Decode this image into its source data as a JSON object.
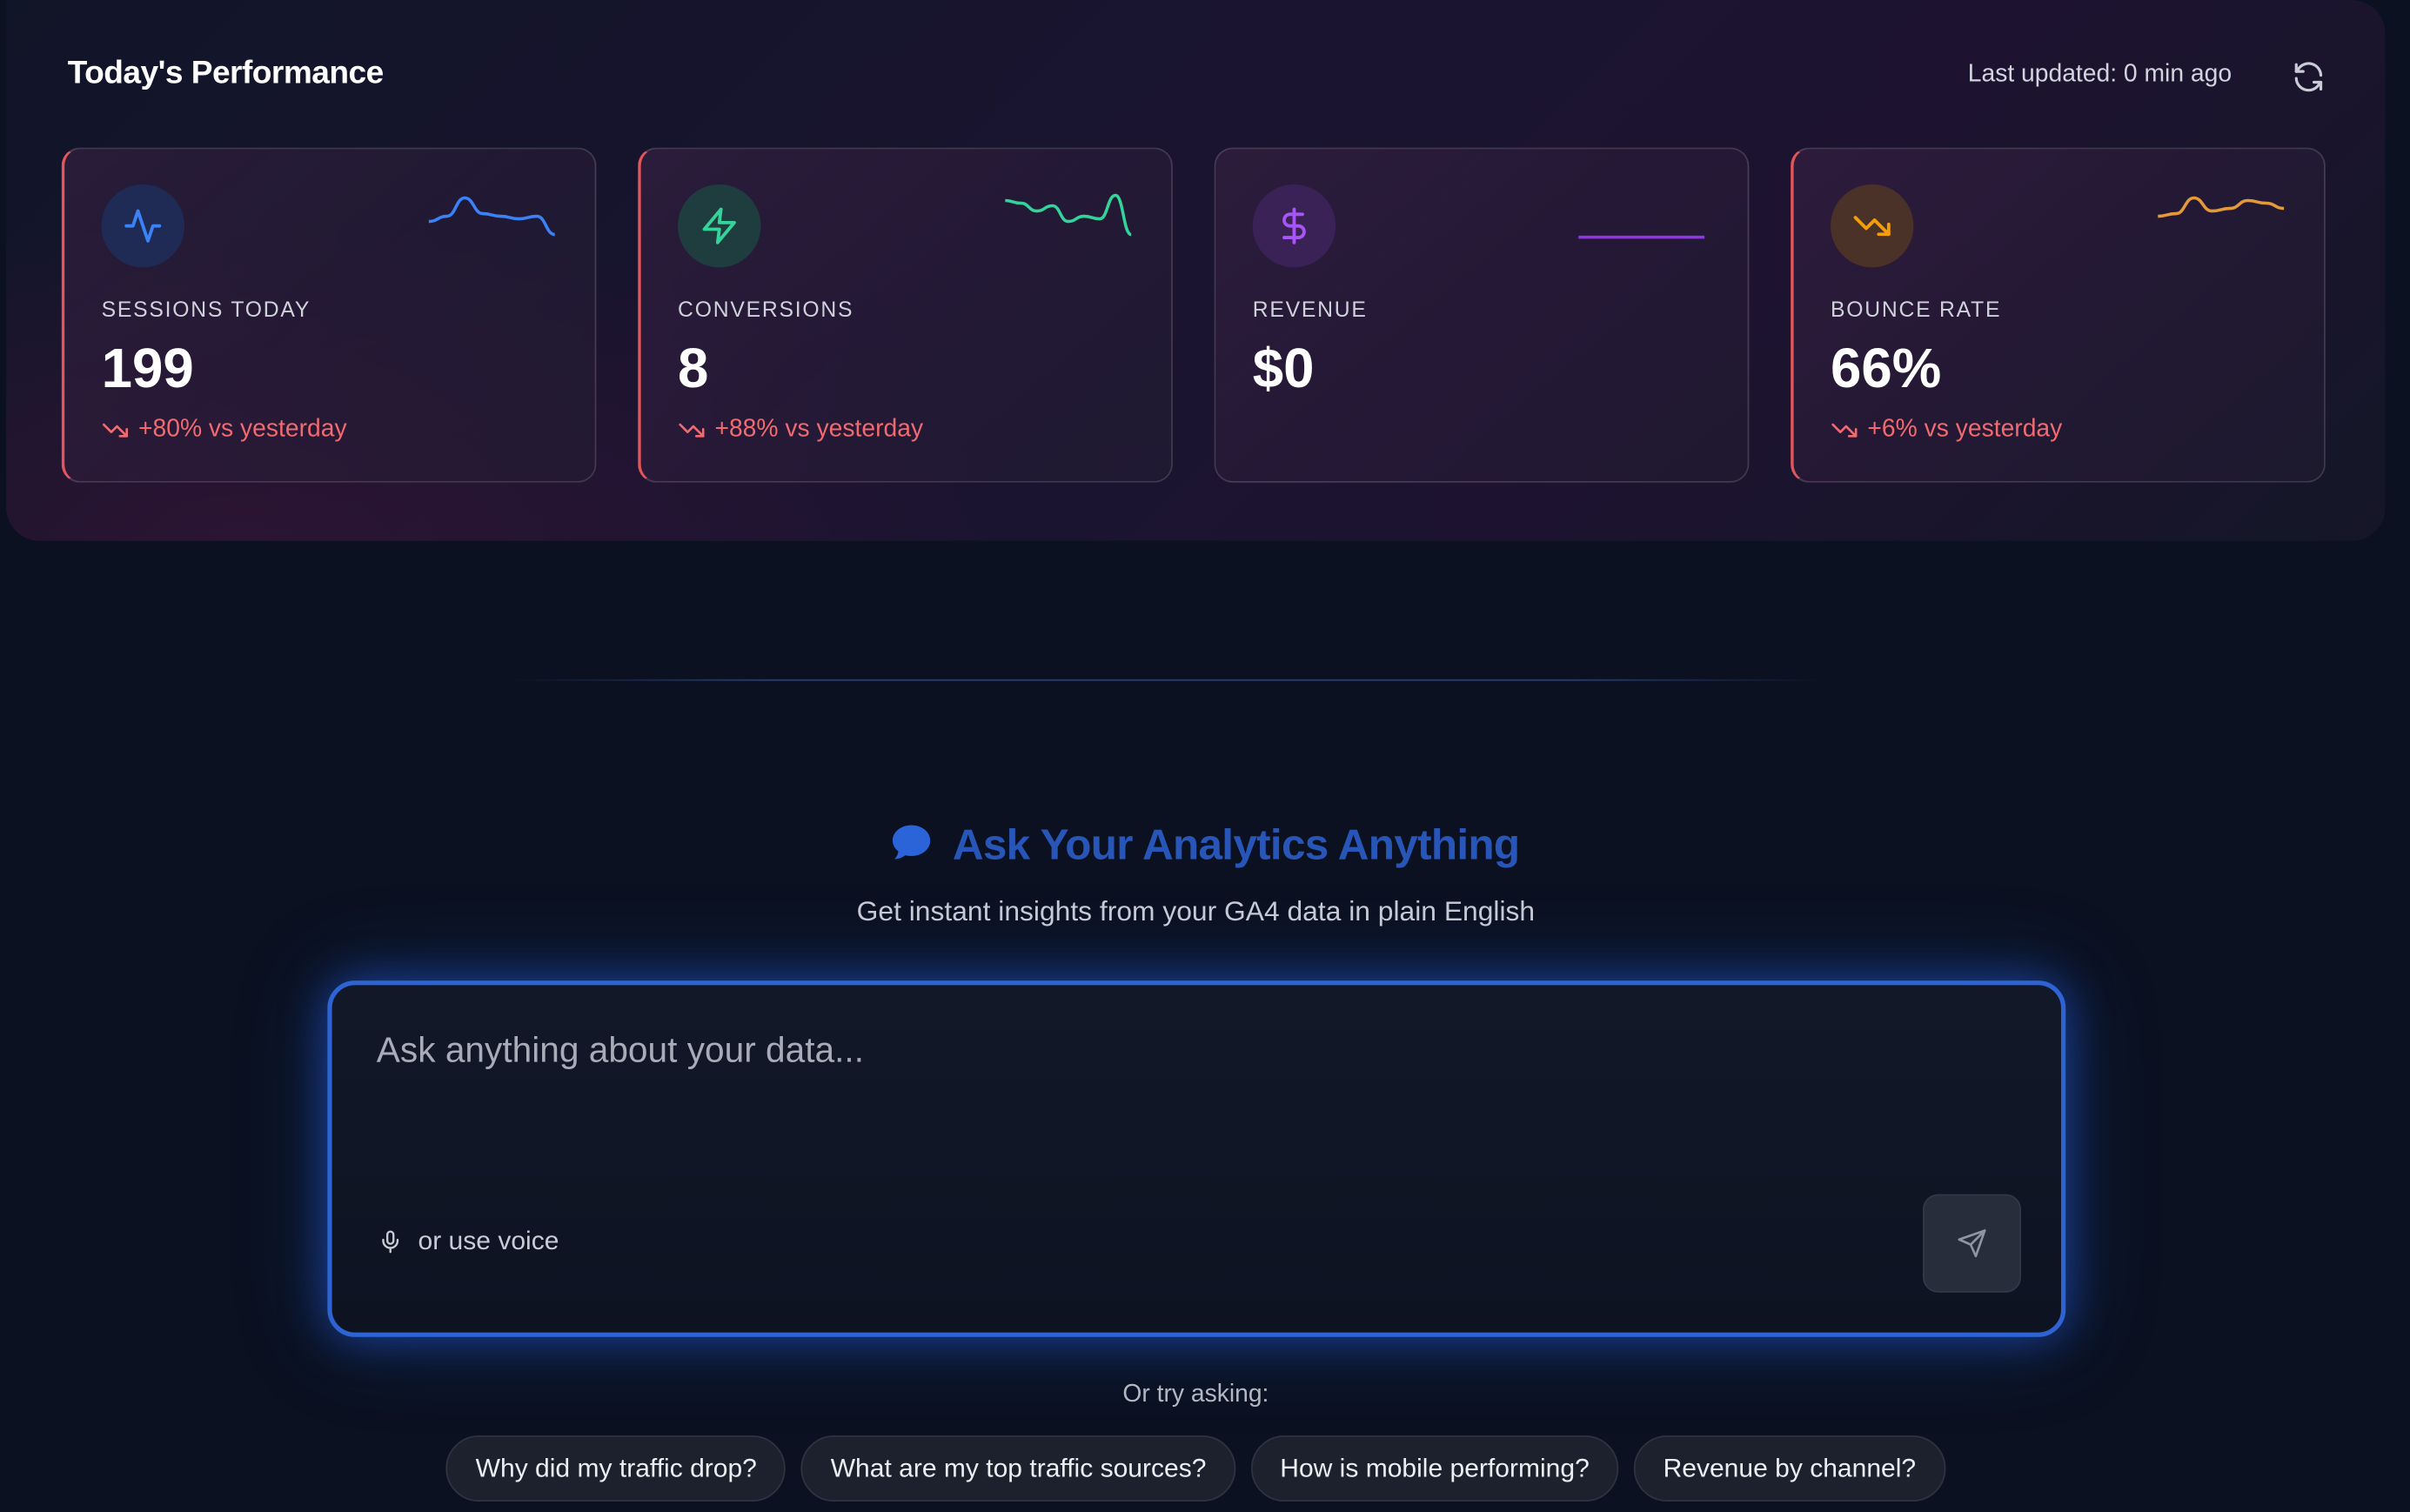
{
  "performance": {
    "title": "Today's Performance",
    "last_updated": "Last updated: 0 min ago",
    "refresh_icon": "refresh-icon",
    "cards": [
      {
        "icon": "activity-icon",
        "icon_color": "#3b82f6",
        "label": "SESSIONS TODAY",
        "value": "199",
        "change": "+80% vs yesterday",
        "change_icon": "trending-down-icon",
        "sparkline_color": "#3b82f6",
        "sparkline": [
          0.35,
          0.45,
          0.8,
          0.5,
          0.45,
          0.4,
          0.45,
          0.1
        ]
      },
      {
        "icon": "zap-icon",
        "icon_color": "#34d399",
        "label": "CONVERSIONS",
        "value": "8",
        "change": "+88% vs yesterday",
        "change_icon": "trending-down-icon",
        "sparkline_color": "#34d399",
        "sparkline": [
          0.75,
          0.7,
          0.55,
          0.65,
          0.35,
          0.45,
          0.4,
          0.85,
          0.1
        ]
      },
      {
        "icon": "dollar-icon",
        "icon_color": "#a855f7",
        "label": "REVENUE",
        "value": "$0",
        "change": "",
        "change_icon": "",
        "sparkline_color": "#9333ea",
        "sparkline": [
          0.05,
          0.05,
          0.05,
          0.05,
          0.05,
          0.05,
          0.05,
          0.05
        ]
      },
      {
        "icon": "trending-down-icon",
        "icon_color": "#f59e0b",
        "label": "BOUNCE RATE",
        "value": "66%",
        "change": "+6% vs yesterday",
        "change_icon": "trending-down-icon",
        "sparkline_color": "#e59a3a",
        "sparkline": [
          0.45,
          0.5,
          0.8,
          0.55,
          0.6,
          0.75,
          0.7,
          0.6
        ]
      }
    ]
  },
  "ask": {
    "title_icon": "chat-bubble-icon",
    "title": "Ask Your Analytics Anything",
    "subtitle": "Get instant insights from your GA4 data in plain English",
    "placeholder": "Ask anything about your data...",
    "voice_icon": "microphone-icon",
    "voice_label": "or use voice",
    "send_icon": "send-icon",
    "try_label": "Or try asking:",
    "suggestions": [
      "Why did my traffic drop?",
      "What are my top traffic sources?",
      "How is mobile performing?",
      "Revenue by channel?"
    ]
  }
}
